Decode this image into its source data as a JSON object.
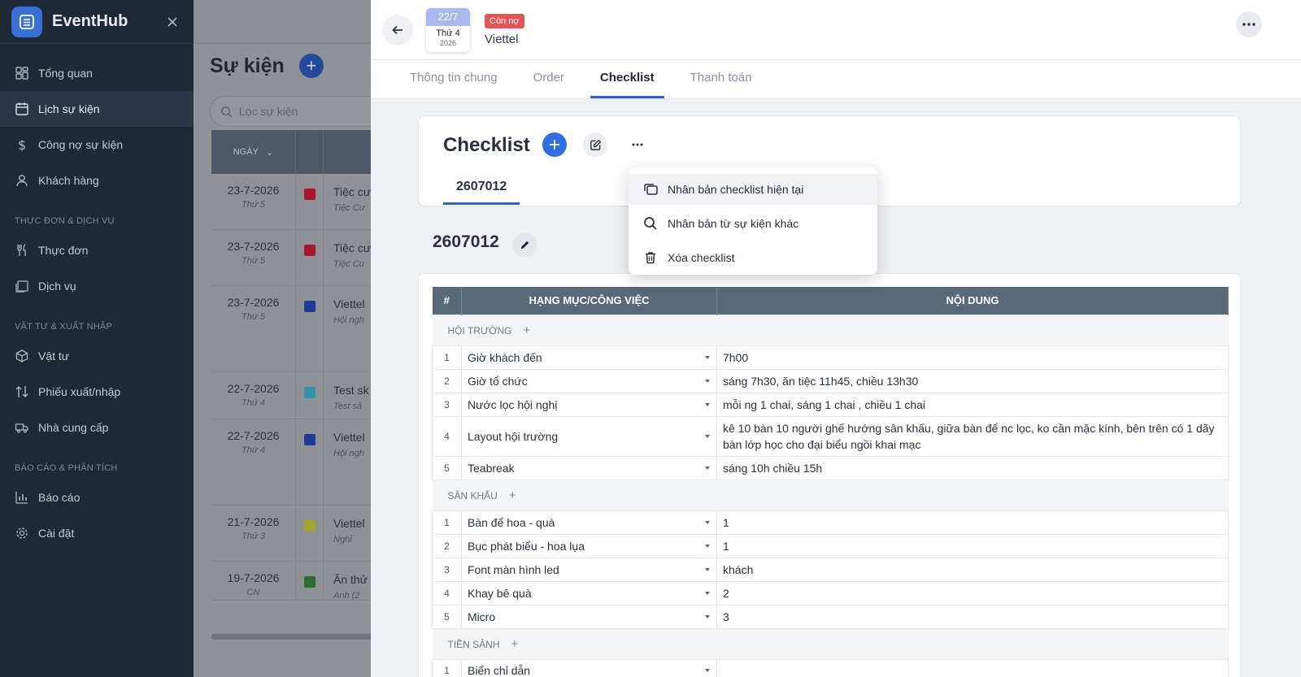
{
  "app": {
    "name": "EventHub"
  },
  "sidebar": {
    "items": [
      {
        "label": "Tổng quan",
        "icon": "dashboard-icon"
      },
      {
        "label": "Lịch sự kiện",
        "icon": "calendar-icon",
        "active": true
      },
      {
        "label": "Công nợ sự kiện",
        "icon": "dollar-icon"
      },
      {
        "label": "Khách hàng",
        "icon": "user-icon"
      }
    ],
    "section_menu": "THỰC ĐƠN & DỊCH VỤ",
    "menu_items": [
      {
        "label": "Thực đơn",
        "icon": "fork-knife-icon"
      },
      {
        "label": "Dịch vụ",
        "icon": "service-icon"
      }
    ],
    "section_supply": "VẬT TƯ & XUẤT NHẬP",
    "supply_items": [
      {
        "label": "Vật tư",
        "icon": "box-icon"
      },
      {
        "label": "Phiếu xuất/nhập",
        "icon": "arrows-updown-icon"
      },
      {
        "label": "Nhà cung cấp",
        "icon": "truck-icon"
      }
    ],
    "section_report": "BÁO CÁO & PHÂN TÍCH",
    "report_items": [
      {
        "label": "Báo cáo",
        "icon": "bar-chart-icon"
      },
      {
        "label": "Cài đặt",
        "icon": "gear-icon"
      }
    ]
  },
  "events": {
    "title": "Sự kiện",
    "filter_placeholder": "Lọc sự kiện",
    "col_date": "NGÀY",
    "rows": [
      {
        "date": "23-7-2026",
        "weekday": "Thứ 5",
        "color": "#a3182f",
        "name": "Tiệc cư",
        "sub": "Tiệc Cư",
        "height": 69
      },
      {
        "date": "23-7-2026",
        "weekday": "Thứ 5",
        "color": "#a3182f",
        "name": "Tiệc cư",
        "sub": "Tiệc Cu",
        "height": 69
      },
      {
        "date": "23-7-2026",
        "weekday": "Thứ 5",
        "color": "#22399b",
        "name": "Viettel",
        "sub": "Hội ngh",
        "height": 106
      },
      {
        "date": "22-7-2026",
        "weekday": "Thứ 4",
        "color": "#3293a8",
        "name": "Test sk",
        "sub": "Test sả",
        "height": 58
      },
      {
        "date": "22-7-2026",
        "weekday": "Thứ 4",
        "color": "#22399b",
        "name": "Viettel",
        "sub": "Hội ngh",
        "height": 106
      },
      {
        "date": "21-7-2026",
        "weekday": "Thứ 3",
        "color": "#a3a431",
        "name": "Viettel",
        "sub": "Nghỉ",
        "height": 69
      },
      {
        "date": "19-7-2026",
        "weekday": "CN",
        "color": "#2a6d2f",
        "name": "Ăn thử",
        "sub": "Anh (2",
        "height": 48
      }
    ]
  },
  "detail": {
    "date_day": "22/7",
    "date_weekday": "Thứ 4",
    "date_year": "2026",
    "badge": "Còn nợ",
    "event_name": "Viettel",
    "tabs": [
      "Thông tin chung",
      "Order",
      "Checklist",
      "Thanh toán"
    ],
    "active_tab": "Checklist",
    "checklist_title": "Checklist",
    "checklist_tab": "2607012",
    "section_title": "2607012",
    "menu": [
      {
        "label": "Nhân bản checklist hiện tại",
        "icon": "copy-icon"
      },
      {
        "label": "Nhân bản từ sự kiện khác",
        "icon": "search-icon"
      },
      {
        "label": "Xóa checklist",
        "icon": "trash-icon"
      }
    ],
    "table": {
      "headers": [
        "#",
        "HẠNG MỤC/CÔNG VIỆC",
        "NỘI DUNG"
      ],
      "groups": [
        {
          "name": "HỘI TRƯỜNG",
          "rows": [
            {
              "num": "1",
              "item": "Giờ khách đến",
              "content": "7h00"
            },
            {
              "num": "2",
              "item": "Giờ tổ chức",
              "content": "sáng  7h30, ăn tiệc 11h45, chiều 13h30"
            },
            {
              "num": "3",
              "item": "Nước lọc hội nghị",
              "content": "mỗi ng 1 chai, sáng 1 chai , chiều 1 chai"
            },
            {
              "num": "4",
              "item": "Layout hội trường",
              "content": "kê 10 bàn 10 người ghế hướng sân khấu, giữa bàn để nc lọc, ko cần mặc kính, bên trên có 1 dãy bàn lớp học cho đại biểu ngồi khai mạc"
            },
            {
              "num": "5",
              "item": "Teabreak",
              "content": "sáng 10h chiều 15h"
            }
          ]
        },
        {
          "name": "SÂN KHẤU",
          "rows": [
            {
              "num": "1",
              "item": "Bàn để hoa - quà",
              "content": "1"
            },
            {
              "num": "2",
              "item": "Bục phát biểu - hoa lụa",
              "content": "1"
            },
            {
              "num": "3",
              "item": "Font màn hình led",
              "content": "khách"
            },
            {
              "num": "4",
              "item": "Khay bê quà",
              "content": "2"
            },
            {
              "num": "5",
              "item": "Micro",
              "content": "3"
            }
          ]
        },
        {
          "name": "TIỀN SẢNH",
          "rows": [
            {
              "num": "1",
              "item": "Biển chỉ dẫn",
              "content": ""
            }
          ]
        }
      ]
    }
  }
}
